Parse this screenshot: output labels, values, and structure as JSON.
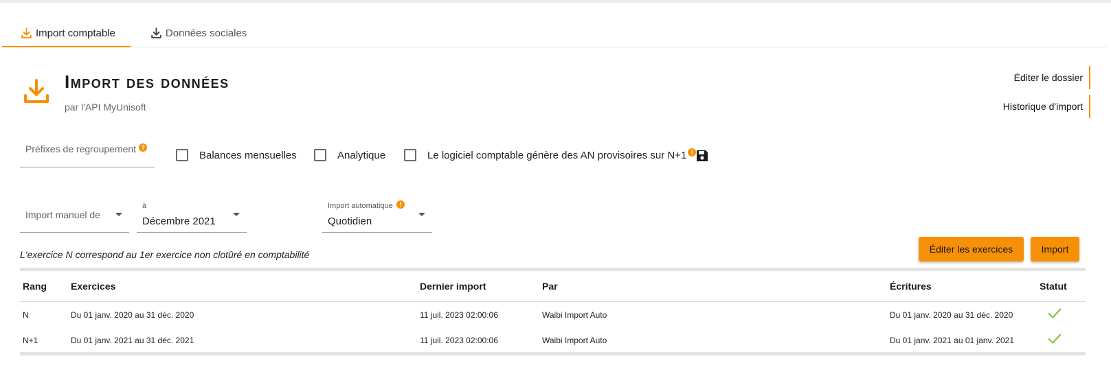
{
  "tabs": [
    {
      "label": "Import comptable",
      "icon": "download-icon",
      "active": true
    },
    {
      "label": "Données sociales",
      "icon": "download-icon",
      "active": false
    }
  ],
  "header": {
    "title": "Import des données",
    "subtitle": "par l'API MyUnisoft",
    "icon": "download-icon"
  },
  "side_links": {
    "edit_folder": "Éditer le dossier",
    "import_history": "Historique d'import"
  },
  "options": {
    "prefix_label": "Préfixes de regroupement",
    "help_mark": "?",
    "checkboxes": [
      {
        "label": "Balances mensuelles",
        "checked": false
      },
      {
        "label": "Analytique",
        "checked": false
      },
      {
        "label": "Le logiciel comptable génère des AN provisoires sur N+1",
        "checked": false
      }
    ],
    "info_mark": "!"
  },
  "selects": {
    "import_from": {
      "placeholder": "Import manuel de"
    },
    "import_to": {
      "label": "à",
      "value": "Décembre 2021"
    },
    "auto_import": {
      "label": "Import automatique",
      "value": "Quotidien"
    }
  },
  "note": "L'exercice N correspond au 1er exercice non clotûré en comptabilité",
  "buttons": {
    "edit_exercises": "Éditer les exercices",
    "import": "Import"
  },
  "table": {
    "headers": [
      "Rang",
      "Exercices",
      "Dernier import",
      "Par",
      "Écritures",
      "Statut"
    ],
    "rows": [
      {
        "rang": "N",
        "exercice": "Du 01 janv. 2020 au 31 déc. 2020",
        "dernier_import": "11 juil. 2023 02:00:06",
        "par": "Waibi Import Auto",
        "ecritures": "Du 01 janv. 2020 au 31 déc. 2020",
        "statut": "ok"
      },
      {
        "rang": "N+1",
        "exercice": "Du 01 janv. 2021 au 31 déc. 2021",
        "dernier_import": "11 juil. 2023 02:00:06",
        "par": "Waibi Import Auto",
        "ecritures": "Du 01 janv. 2021 au 01 janv. 2021",
        "statut": "ok"
      }
    ]
  },
  "colors": {
    "accent": "#f79009",
    "check_ok": "#8bc34a"
  }
}
